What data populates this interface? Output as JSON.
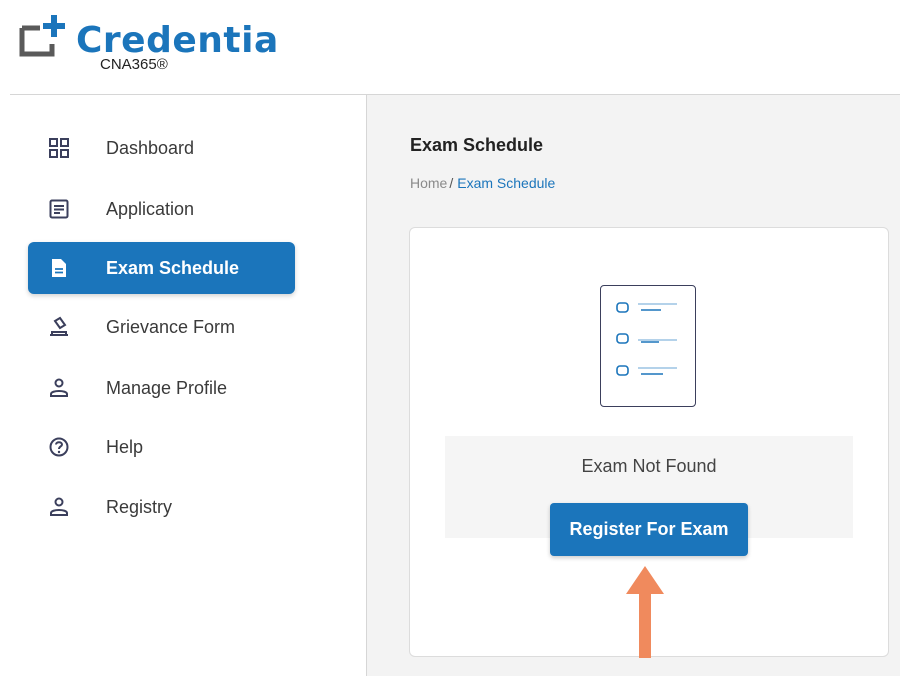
{
  "brand": {
    "name": "Credentia",
    "subtitle": "CNA365®",
    "accent_color": "#1b75bb"
  },
  "sidebar": {
    "items": [
      {
        "label": "Dashboard",
        "icon": "dashboard-grid-icon",
        "active": false
      },
      {
        "label": "Application",
        "icon": "document-list-icon",
        "active": false
      },
      {
        "label": "Exam Schedule",
        "icon": "file-icon",
        "active": true
      },
      {
        "label": "Grievance Form",
        "icon": "gavel-icon",
        "active": false
      },
      {
        "label": "Manage Profile",
        "icon": "person-icon",
        "active": false
      },
      {
        "label": "Help",
        "icon": "question-circle-icon",
        "active": false
      },
      {
        "label": "Registry",
        "icon": "person-icon",
        "active": false
      }
    ]
  },
  "main": {
    "title": "Exam Schedule",
    "breadcrumb": {
      "home": "Home",
      "separator": "/",
      "current": "Exam Schedule"
    },
    "empty_state": {
      "illustration_icon": "checklist-icon",
      "message": "Exam Not Found",
      "button_label": "Register For Exam"
    }
  },
  "annotation": {
    "arrow_icon": "up-arrow-icon",
    "arrow_color": "#f08a5d"
  }
}
